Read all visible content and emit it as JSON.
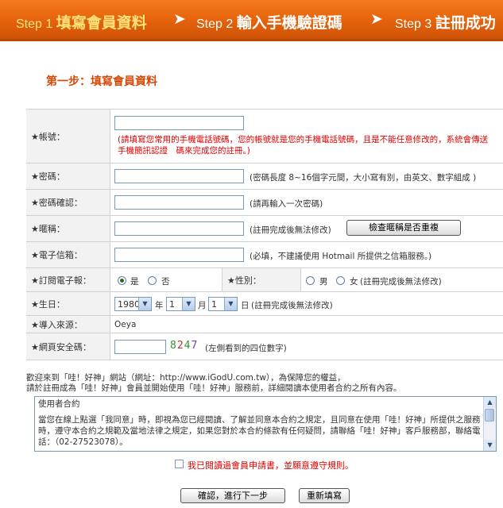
{
  "steps": [
    {
      "num": "Step 1",
      "label": "填寫會員資料",
      "active": true
    },
    {
      "num": "Step 2",
      "label": "輸入手機驗證碼",
      "active": false
    },
    {
      "num": "Step 3",
      "label": "註冊成功",
      "active": false
    }
  ],
  "arrow_glyph": "➤",
  "page_title": "第一步：填寫會員資料",
  "form": {
    "account": {
      "label": "★帳號：",
      "value": "",
      "hint": "(請填寫您常用的手機電話號碼，您的帳號就是您的手機電話號碼，且是不能任意修改的，系統會傳送手機簡訊認證　碼來完成您的註冊。)"
    },
    "password": {
      "label": "★密碼：",
      "value": "",
      "hint": "(密碼長度 8~16個字元間，大小寫有別，由英文、數字組成 )"
    },
    "password_confirm": {
      "label": "★密碼確認：",
      "value": "",
      "hint": "(請再輸入一次密碼)"
    },
    "nickname": {
      "label": "★暱稱：",
      "value": "",
      "hint": "(註冊完成後無法修改)",
      "check_button": "檢查暱稱是否重複"
    },
    "email": {
      "label": "★電子信箱：",
      "value": "",
      "hint": "(必填，不建議使用 Hotmail 所提供之信箱服務。)"
    },
    "newsletter": {
      "label": "★訂閱電子報：",
      "options": [
        "是",
        "否"
      ],
      "selected": "是"
    },
    "gender": {
      "label": "★性別：",
      "options": [
        "男",
        "女"
      ],
      "selected": "",
      "hint": "(註冊完成後無法修改)"
    },
    "birthday": {
      "label": "★生日：",
      "year": "1980",
      "year_unit": "年",
      "month": "1",
      "month_unit": "月",
      "day": "1",
      "day_unit": "日",
      "hint": "(註冊完成後無法修改)"
    },
    "source": {
      "label": "★導入來源：",
      "value": "Oeya"
    },
    "security": {
      "label": "★網頁安全碼：",
      "value": "",
      "captcha": [
        "8",
        "2",
        "4",
        "7"
      ],
      "captcha_colors": [
        "#2a9a2a",
        "#c03030",
        "#2a9a2a",
        "#7a3ab0"
      ],
      "hint": "(左側看到的四位數字)"
    }
  },
  "welcome_line1": "歡迎來到「哇！好神」網站（網址：http://www.iGodU.com.tw），為保障您的權益，",
  "welcome_line2": "請於註冊成為「哇！好神」會員並開始使用「哇！好神」服務前，詳細閱讀本使用者合約之所有內容。",
  "terms": {
    "title": "使用者合約",
    "body": "當您在線上點選「我同意」時，即視為您已經閱讀、了解並同意本合約之規定，且同意在使用「哇！好神」所提供之服務時，遵守本合約之規範及當地法律之規定，如果您對於本合約條款有任何疑問，請聯絡「哇！好神」客戶服務部，聯絡電話：（02-27523078）。"
  },
  "agree_text": "我已閱讀過會員申請書，並願意遵守規則。",
  "submit_button": "確認，進行下一步",
  "reset_button": "重新填寫",
  "colors": {
    "banner": "#e4620b",
    "title": "#d44a0a",
    "hint_red": "#e00000"
  }
}
